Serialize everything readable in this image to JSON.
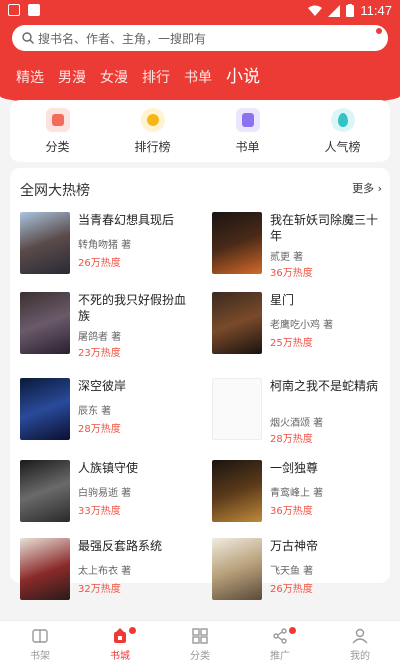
{
  "status_bar": {
    "time": "11:47"
  },
  "search": {
    "placeholder": "搜书名、作者、主角，一搜即有"
  },
  "category_tabs": [
    {
      "label": "精选"
    },
    {
      "label": "男漫"
    },
    {
      "label": "女漫"
    },
    {
      "label": "排行"
    },
    {
      "label": "书单"
    },
    {
      "label": "小说"
    }
  ],
  "quick": [
    {
      "label": "分类",
      "color": "#f26b5b"
    },
    {
      "label": "排行榜",
      "color": "#f5b718"
    },
    {
      "label": "书单",
      "color": "#8c72ef"
    },
    {
      "label": "人气榜",
      "color": "#34c2c7"
    }
  ],
  "hot": {
    "title": "全网大热榜",
    "more": "更多",
    "books": [
      {
        "title": "当青春幻想具现后",
        "author": "转角吻猪 著",
        "heat": "26万热度"
      },
      {
        "title": "我在斩妖司除魔三十年",
        "author": "贰更 著",
        "heat": "36万热度"
      },
      {
        "title": "不死的我只好假扮血族",
        "author": "屠鸽者 著",
        "heat": "23万热度"
      },
      {
        "title": "星门",
        "author": "老鹰吃小鸡 著",
        "heat": "25万热度"
      },
      {
        "title": "深空彼岸",
        "author": "辰东 著",
        "heat": "28万热度"
      },
      {
        "title": "柯南之我不是蛇精病",
        "author": "烟火酒颂 著",
        "heat": "28万热度"
      },
      {
        "title": "人族镇守使",
        "author": "白驹易逝 著",
        "heat": "33万热度"
      },
      {
        "title": "一剑独尊",
        "author": "青鸾峰上 著",
        "heat": "36万热度"
      },
      {
        "title": "最强反套路系统",
        "author": "太上布衣 著",
        "heat": "32万热度"
      },
      {
        "title": "万古神帝",
        "author": "飞天鱼 著",
        "heat": "26万热度"
      }
    ]
  },
  "nav": [
    {
      "label": "书架"
    },
    {
      "label": "书城"
    },
    {
      "label": "分类"
    },
    {
      "label": "推广"
    },
    {
      "label": "我的"
    }
  ],
  "colors": {
    "brand": "#ec3b35",
    "heat": "#ef5244"
  }
}
